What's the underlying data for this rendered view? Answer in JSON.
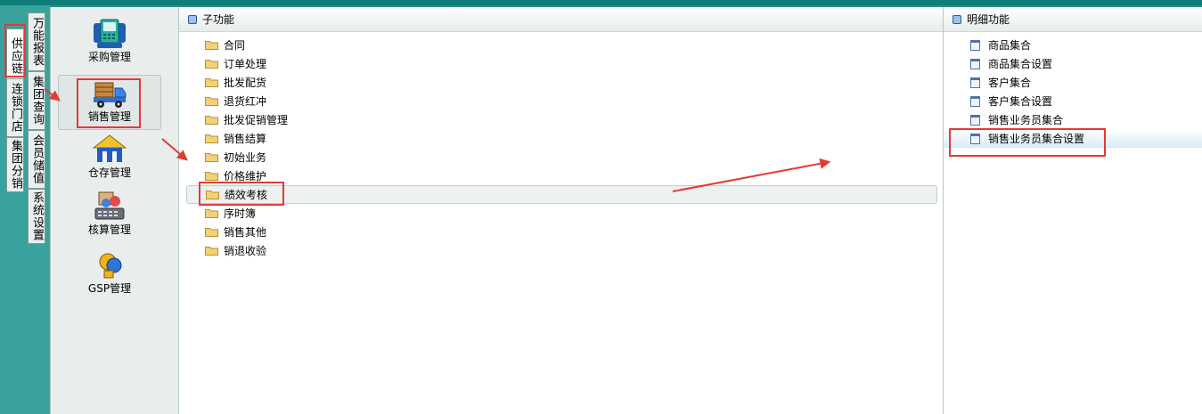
{
  "left_tabs": {
    "col1": [
      "供应链",
      "连锁门店",
      "集团分销"
    ],
    "col2": [
      "万能报表",
      "集团查询",
      "会员储值",
      "系统设置"
    ]
  },
  "modules": [
    {
      "label": "采购管理",
      "icon": "purchase-icon"
    },
    {
      "label": "销售管理",
      "icon": "sales-truck-icon"
    },
    {
      "label": "仓存管理",
      "icon": "warehouse-icon"
    },
    {
      "label": "核算管理",
      "icon": "accounting-icon"
    },
    {
      "label": "GSP管理",
      "icon": "gsp-icon"
    }
  ],
  "sub_panel": {
    "title": "子功能",
    "items": [
      "合同",
      "订单处理",
      "批发配货",
      "退货红冲",
      "批发促销管理",
      "销售结算",
      "初始业务",
      "价格维护",
      "绩效考核",
      "序时簿",
      "销售其他",
      "销退收验"
    ],
    "selected_index": 8
  },
  "detail_panel": {
    "title": "明细功能",
    "items": [
      "商品集合",
      "商品集合设置",
      "客户集合",
      "客户集合设置",
      "销售业务员集合",
      "销售业务员集合设置"
    ],
    "selected_index": 5
  },
  "colors": {
    "background": "#2a8f8a",
    "highlight_box": "#e53935",
    "arrow": "#e53935",
    "folder": "#f3d277"
  }
}
